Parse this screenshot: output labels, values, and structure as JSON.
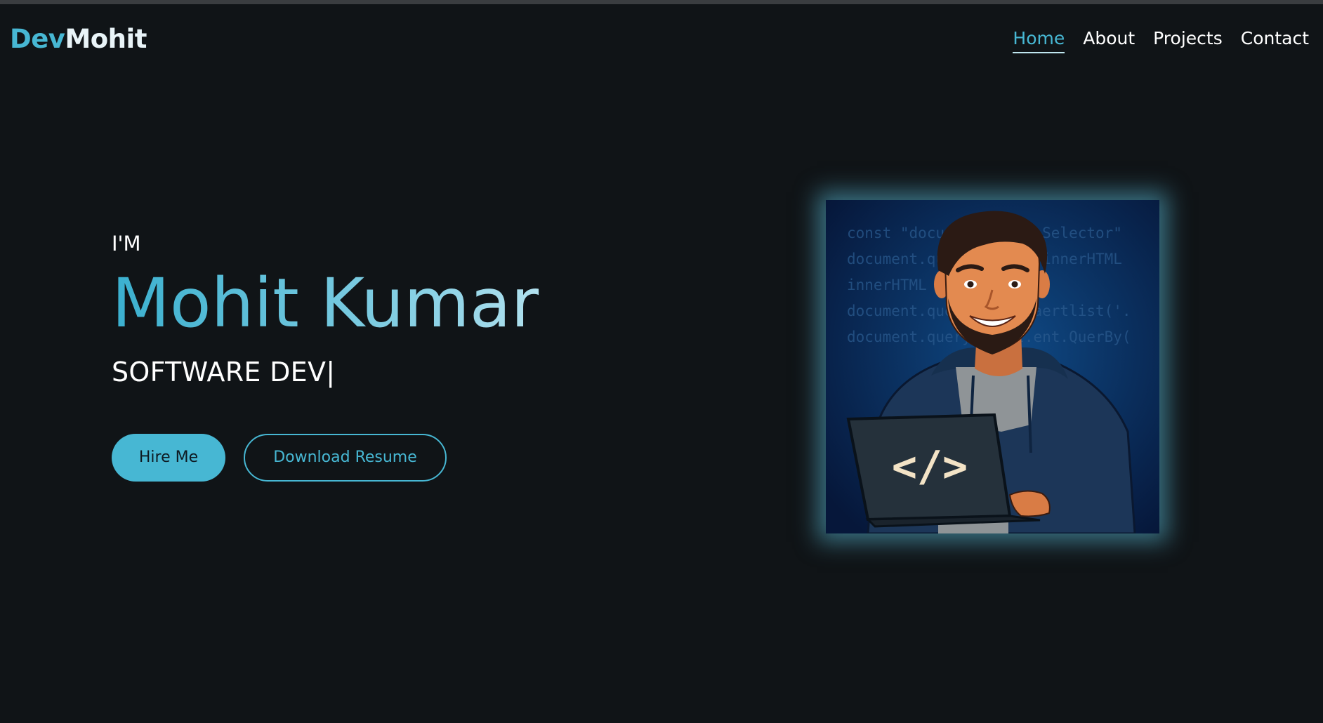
{
  "logo": {
    "part1": "Dev",
    "part2": "Mohit"
  },
  "nav": {
    "items": [
      {
        "label": "Home",
        "active": true
      },
      {
        "label": "About",
        "active": false
      },
      {
        "label": "Projects",
        "active": false
      },
      {
        "label": "Contact",
        "active": false
      }
    ]
  },
  "hero": {
    "intro": "I'M",
    "name": "Mohit Kumar",
    "role": "SOFTWARE DEV",
    "cursor": "|",
    "hire_label": "Hire Me",
    "resume_label": "Download Resume"
  },
  "avatar": {
    "code_lines": [
      "const \"document.Query.Selector\"",
      "document.querySelect.'innerHTML",
      "innerHTML",
      "document.querySelect.aertlist('.",
      "document.querySelect.ent.QuerBy("
    ],
    "laptop_symbol": "</>"
  },
  "colors": {
    "accent": "#47b7d3",
    "background": "#101417",
    "hoodie": "#1c3658",
    "image_bg": "#0a2248"
  }
}
